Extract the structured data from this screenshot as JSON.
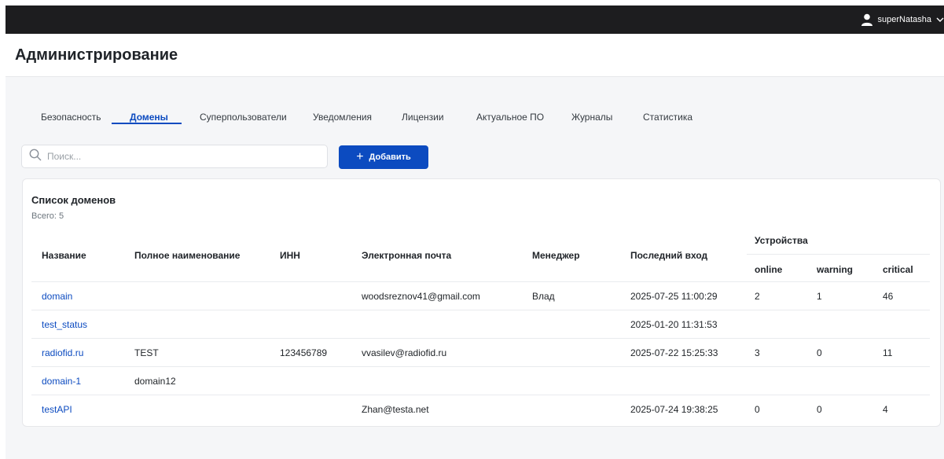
{
  "topbar": {
    "username": "superNatasha",
    "user_icon": "user-icon",
    "chevron_icon": "chevron-down-icon"
  },
  "page": {
    "title": "Администрирование"
  },
  "tabs": [
    {
      "label": "Безопасность",
      "active": false
    },
    {
      "label": "Домены",
      "active": true
    },
    {
      "label": "Суперпользователи",
      "active": false
    },
    {
      "label": "Уведомления",
      "active": false
    },
    {
      "label": "Лицензии",
      "active": false
    },
    {
      "label": "Актуальное ПО",
      "active": false
    },
    {
      "label": "Журналы",
      "active": false
    },
    {
      "label": "Статистика",
      "active": false
    }
  ],
  "search": {
    "placeholder": "Поиск...",
    "value": "",
    "icon": "search-icon"
  },
  "add_button": {
    "label": "Добавить",
    "icon": "+"
  },
  "domains": {
    "title": "Список доменов",
    "count": "Всего: 5",
    "columns": {
      "name": "Название",
      "full_name": "Полное наименование",
      "inn": "ИНН",
      "email": "Электронная почта",
      "manager": "Менеджер",
      "last_login": "Последний вход",
      "devices": "Устройства",
      "online": "online",
      "warning": "warning",
      "critical": "critical"
    },
    "rows": [
      {
        "name": "domain",
        "full_name": "",
        "inn": "",
        "email": "woodsreznov41@gmail.com",
        "manager": "Влад",
        "last_login": "2025-07-25 11:00:29",
        "online": "2",
        "warning": "1",
        "critical": "46"
      },
      {
        "name": "test_status",
        "full_name": "",
        "inn": "",
        "email": "",
        "manager": "",
        "last_login": "2025-01-20 11:31:53",
        "online": "",
        "warning": "",
        "critical": ""
      },
      {
        "name": "radiofid.ru",
        "full_name": "TEST",
        "inn": "123456789",
        "email": "vvasilev@radiofid.ru",
        "manager": "",
        "last_login": "2025-07-22 15:25:33",
        "online": "3",
        "warning": "0",
        "critical": "11"
      },
      {
        "name": "domain-1",
        "full_name": "domain12",
        "inn": "",
        "email": "",
        "manager": "",
        "last_login": "",
        "online": "",
        "warning": "",
        "critical": ""
      },
      {
        "name": "testAPI",
        "full_name": "",
        "inn": "",
        "email": "Zhan@testa.net",
        "manager": "",
        "last_login": "2025-07-24 19:38:25",
        "online": "0",
        "warning": "0",
        "critical": "4"
      }
    ]
  },
  "colors": {
    "accent": "#0c4bc0",
    "topbar": "#1d1d1f",
    "background": "#f5f6f8"
  }
}
